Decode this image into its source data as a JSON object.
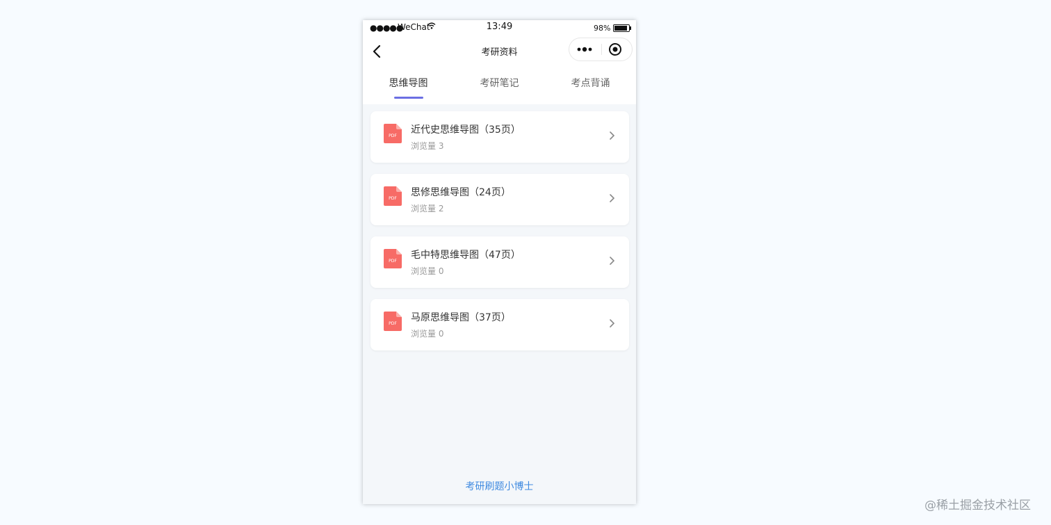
{
  "status_bar": {
    "signal": "●●●●●",
    "carrier": "WeChat",
    "time": "13:49",
    "battery": "98%"
  },
  "nav": {
    "title": "考研资料"
  },
  "tabs": [
    {
      "label": "思维导图",
      "active": true
    },
    {
      "label": "考研笔记",
      "active": false
    },
    {
      "label": "考点背诵",
      "active": false
    }
  ],
  "documents": [
    {
      "title": "近代史思维导图（35页）",
      "views": "浏览量 3",
      "icon_text": "PDF"
    },
    {
      "title": "思修思维导图（24页）",
      "views": "浏览量 2",
      "icon_text": "PDF"
    },
    {
      "title": "毛中特思维导图（47页）",
      "views": "浏览量 0",
      "icon_text": "PDF"
    },
    {
      "title": "马原思维导图（37页）",
      "views": "浏览量 0",
      "icon_text": "PDF"
    }
  ],
  "footer": {
    "link_label": "考研刷题小博士"
  },
  "watermark": "@稀土掘金技术社区",
  "colors": {
    "accent": "#6b6fe3",
    "link": "#3f8ae0",
    "pdf_icon": "#f76b66",
    "background": "#f4f7fa"
  }
}
